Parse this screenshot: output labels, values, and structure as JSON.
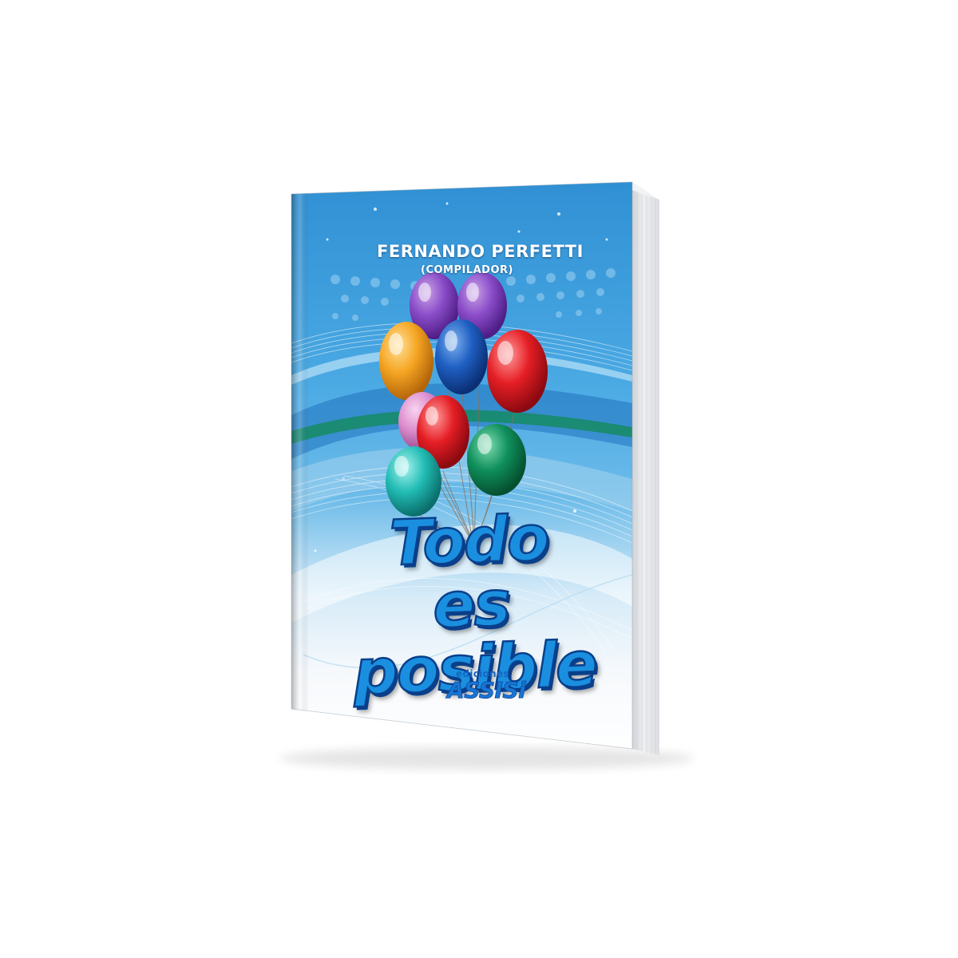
{
  "book": {
    "author": "FERNANDO PERFETTI",
    "role": "(COMPILADOR)",
    "title_line1": "Todo es",
    "title_line2": "posible",
    "publisher_small": "ediciones",
    "publisher_big": "ASSISi"
  },
  "colors": {
    "cover_blue": "#3d9fdc",
    "title_fill": "#1a8fe0",
    "title_outline": "#0a3f8a",
    "pages": "#e9eaec"
  },
  "balloons": [
    "purple",
    "purple",
    "orange",
    "blue",
    "red",
    "pink",
    "red",
    "green",
    "teal"
  ]
}
